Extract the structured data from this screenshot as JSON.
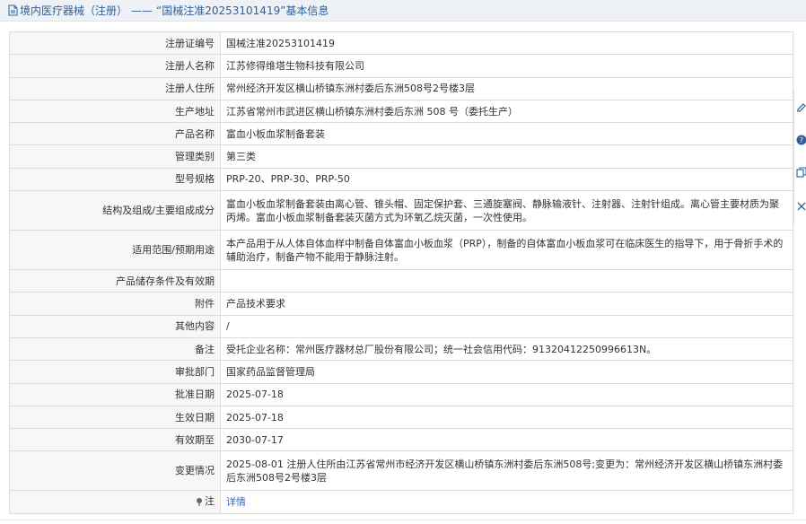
{
  "header": {
    "title_prefix": "境内医疗器械（注册）",
    "separator": "——",
    "title_suffix": "“国械注准20253101419”基本信息"
  },
  "rows": [
    {
      "name": "reg-number",
      "label": "注册证编号",
      "value": "国械注准20253101419"
    },
    {
      "name": "registrant",
      "label": "注册人名称",
      "value": "江苏修得维塔生物科技有限公司"
    },
    {
      "name": "reg-address",
      "label": "注册人住所",
      "value": "常州经济开发区横山桥镇东洲村委后东洲508号2号楼3层"
    },
    {
      "name": "prod-address",
      "label": "生产地址",
      "value": "江苏省常州市武进区横山桥镇东洲村委后东洲 508 号（委托生产）"
    },
    {
      "name": "product-name",
      "label": "产品名称",
      "value": "富血小板血浆制备套装"
    },
    {
      "name": "mgmt-class",
      "label": "管理类别",
      "value": "第三类"
    },
    {
      "name": "model",
      "label": "型号规格",
      "value": "PRP-20、PRP-30、PRP-50"
    },
    {
      "name": "structure",
      "label": "结构及组成/主要组成成分",
      "value": "富血小板血浆制备套装由离心管、锥头帽、固定保护套、三通旋塞阀、静脉输液针、注射器、注射针组成。离心管主要材质为聚丙烯。富血小板血浆制备套装灭菌方式为环氧乙烷灭菌，一次性使用。",
      "tall": true
    },
    {
      "name": "scope",
      "label": "适用范围/预期用途",
      "value": "本产品用于从人体自体血样中制备自体富血小板血浆（PRP），制备的自体富血小板血浆可在临床医生的指导下，用于骨折手术的辅助治疗，制备产物不能用于静脉注射。",
      "tall": true
    },
    {
      "name": "storage",
      "label": "产品储存条件及有效期",
      "value": ""
    },
    {
      "name": "attachment",
      "label": "附件",
      "value": "产品技术要求"
    },
    {
      "name": "other",
      "label": "其他内容",
      "value": "/"
    },
    {
      "name": "remarks",
      "label": "备注",
      "value": "受托企业名称：常州医疗器材总厂股份有限公司；统一社会信用代码：91320412250996613N。"
    },
    {
      "name": "approval-dept",
      "label": "审批部门",
      "value": "国家药品监督管理局"
    },
    {
      "name": "approval-date",
      "label": "批准日期",
      "value": "2025-07-18"
    },
    {
      "name": "effective-date",
      "label": "生效日期",
      "value": "2025-07-18"
    },
    {
      "name": "expiry-date",
      "label": "有效期至",
      "value": "2030-07-17"
    },
    {
      "name": "changes",
      "label": "变更情况",
      "value": "2025-08-01 注册人住所由江苏省常州市经济开发区横山桥镇东洲村委后东洲508号;变更为：常州经济开发区横山桥镇东洲村委后东洲508号2号楼3层",
      "tall": true
    }
  ],
  "note": {
    "label": "注",
    "link_text": "详情"
  },
  "colors": {
    "title": "#2f5f98",
    "link": "#2b6cc4",
    "label_bg": "#f7f7f7",
    "border": "#dcdcdc"
  },
  "icons": [
    "document-icon",
    "pin-icon",
    "edit-icon",
    "help-icon",
    "copy-icon",
    "close-icon"
  ]
}
